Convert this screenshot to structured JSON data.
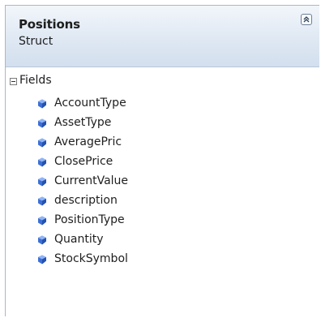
{
  "shape": {
    "name": "Positions",
    "kind": "Struct"
  },
  "section": {
    "label": "Fields",
    "expanded": true
  },
  "fields": [
    "AccountType",
    "AssetType",
    "AveragePric",
    "ClosePrice",
    "CurrentValue",
    "description",
    "PositionType",
    "Quantity",
    "StockSymbol"
  ],
  "icons": {
    "field": "field-icon",
    "collapse": "collapse-chevron-icon",
    "section_toggle": "minus-toggle-icon"
  },
  "colors": {
    "header_top": "#f2f6fb",
    "header_bottom": "#d3dfee",
    "border": "#aab7c8",
    "field_icon": "#3b6fd6"
  }
}
